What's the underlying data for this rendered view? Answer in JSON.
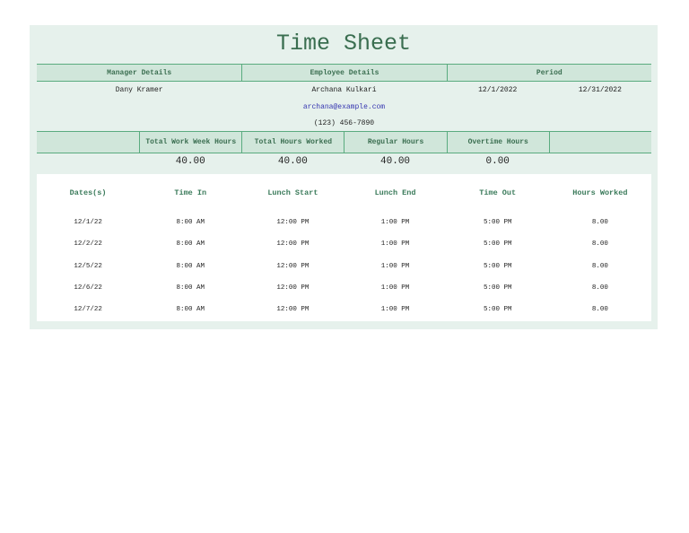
{
  "title": "Time Sheet",
  "details_headers": [
    "Manager Details",
    "Employee Details",
    "Period"
  ],
  "manager": {
    "name": "Dany Kramer"
  },
  "employee": {
    "name": "Archana Kulkari",
    "email": "archana@example.com",
    "phone": "(123) 456-7890"
  },
  "period": {
    "start": "12/1/2022",
    "end": "12/31/2022"
  },
  "summary": {
    "headers": [
      "",
      "Total Work Week Hours",
      "Total Hours Worked",
      "Regular Hours",
      "Overtime Hours",
      ""
    ],
    "values": [
      "",
      "40.00",
      "40.00",
      "40.00",
      "0.00",
      ""
    ]
  },
  "table": {
    "headers": [
      "Dates(s)",
      "Time In",
      "Lunch Start",
      "Lunch End",
      "Time Out",
      "Hours Worked"
    ],
    "rows": [
      [
        "12/1/22",
        "8:00 AM",
        "12:00 PM",
        "1:00 PM",
        "5:00 PM",
        "8.00"
      ],
      [
        "12/2/22",
        "8:00 AM",
        "12:00 PM",
        "1:00 PM",
        "5:00 PM",
        "8.00"
      ],
      [
        "12/5/22",
        "8:00 AM",
        "12:00 PM",
        "1:00 PM",
        "5:00 PM",
        "8.00"
      ],
      [
        "12/6/22",
        "8:00 AM",
        "12:00 PM",
        "1:00 PM",
        "5:00 PM",
        "8.00"
      ],
      [
        "12/7/22",
        "8:00 AM",
        "12:00 PM",
        "1:00 PM",
        "5:00 PM",
        "8.00"
      ]
    ]
  }
}
